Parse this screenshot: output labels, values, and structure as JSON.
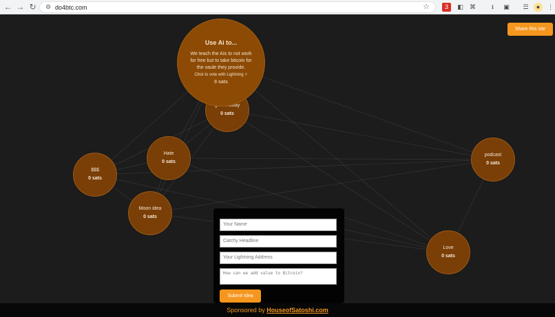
{
  "browser": {
    "url": "do4btc.com",
    "extension_badge": "3"
  },
  "share_button": "Share this site",
  "featured": {
    "title": "Use Ai to...",
    "description": "We teach the AIs to not work for free but to take bitcoin for the vaule they provide.",
    "vote_text": "Click to vote with Lightning ⚡",
    "sats": "0 sats"
  },
  "ideas": [
    {
      "label": "give it away",
      "sats": "0 sats"
    },
    {
      "label": "Hate",
      "sats": "0 sats"
    },
    {
      "label": "$$$",
      "sats": "0 sats"
    },
    {
      "label": "Moon idea",
      "sats": "0 sats"
    },
    {
      "label": "podcast",
      "sats": "0 sats"
    },
    {
      "label": "Love",
      "sats": "0 sats"
    }
  ],
  "form": {
    "name_placeholder": "Your Name",
    "headline_placeholder": "Catchy Headline",
    "lightning_placeholder": "Your Lightning Address",
    "idea_placeholder": "How can we add value to Bitcoin?",
    "submit_label": "Submit Idea"
  },
  "footer": {
    "prefix": "Sponsored by",
    "link": "HouseofSatoshi.com"
  },
  "colors": {
    "accent": "#f5961e",
    "node": "#7a3f07",
    "background": "#1c1c1c"
  }
}
